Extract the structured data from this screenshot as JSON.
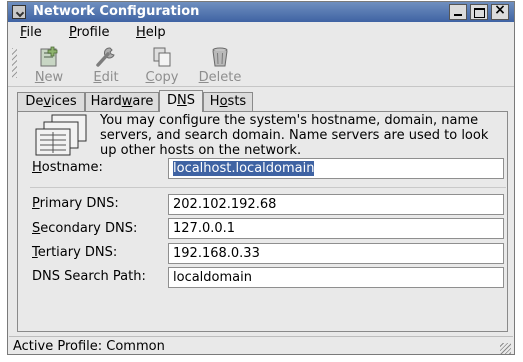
{
  "window": {
    "title": "Network Configuration"
  },
  "menu": {
    "file": "File",
    "profile": "Profile",
    "help": "Help"
  },
  "toolbar": {
    "new": "New",
    "edit": "Edit",
    "copy": "Copy",
    "delete": "Delete"
  },
  "tabs": [
    {
      "label": "Devices"
    },
    {
      "label": "Hardware"
    },
    {
      "label": "DNS",
      "active": true
    },
    {
      "label": "Hosts"
    }
  ],
  "dns": {
    "description": "You may configure the system's hostname, domain, name servers, and search domain. Name servers are used to look up other hosts on the network.",
    "hostname_label": "Hostname:",
    "hostname_value": "localhost.localdomain",
    "primary_label": "Primary DNS:",
    "primary_value": "202.102.192.68",
    "secondary_label": "Secondary DNS:",
    "secondary_value": "127.0.0.1",
    "tertiary_label": "Tertiary DNS:",
    "tertiary_value": "192.168.0.33",
    "search_label": "DNS Search Path:",
    "search_value": "localdomain"
  },
  "status": {
    "text": "Active Profile: Common"
  },
  "icons": {
    "app": "network-config-icon",
    "new": "new-icon",
    "edit": "wrench-icon",
    "copy": "copy-icon",
    "delete": "trash-icon",
    "info": "network-hosts-icon",
    "minimize": "minimize-icon",
    "maximize": "maximize-icon",
    "close": "close-icon"
  },
  "colors": {
    "titlebar": "#3f63a3",
    "selection": "#3f63a3",
    "panel": "#e9e9e9"
  }
}
